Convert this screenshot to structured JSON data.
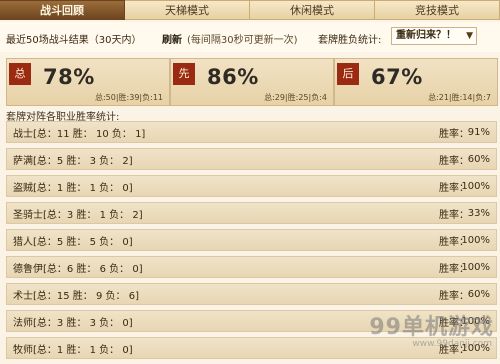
{
  "tabs": [
    {
      "label": "战斗回顾",
      "active": true
    },
    {
      "label": "天梯模式",
      "active": false
    },
    {
      "label": "休闲模式",
      "active": false
    },
    {
      "label": "竞技模式",
      "active": false
    }
  ],
  "filter": {
    "description": "最近50场战斗结果（30天内）",
    "refresh_label": "刷新",
    "refresh_note": "(每间隔30秒可更新一次)",
    "deck_stat_label": "套牌胜负统计:",
    "deck_select_value": "重新归来？！",
    "select_arrow": "▼"
  },
  "summary_cards": [
    {
      "badge": "总",
      "percent": "78%",
      "detail": "总:50|胜:39|负:11"
    },
    {
      "badge": "先",
      "percent": "86%",
      "detail": "总:29|胜:25|负:4"
    },
    {
      "badge": "后",
      "percent": "67%",
      "detail": "总:21|胜:14|负:7"
    }
  ],
  "section_title": "套牌对阵各职业胜率统计:",
  "class_rows": [
    {
      "text": "战士[总：11 胜： 10 负： 1]",
      "rate_label": "胜率：",
      "rate": "91%"
    },
    {
      "text": "萨满[总：5 胜： 3 负： 2]",
      "rate_label": "胜率：",
      "rate": "60%"
    },
    {
      "text": "盗贼[总：1 胜： 1 负： 0]",
      "rate_label": "胜率：",
      "rate": "100%"
    },
    {
      "text": "圣骑士[总：3 胜： 1 负： 2]",
      "rate_label": "胜率：",
      "rate": "33%"
    },
    {
      "text": "猎人[总：5 胜： 5 负： 0]",
      "rate_label": "胜率：",
      "rate": "100%"
    },
    {
      "text": "德鲁伊[总：6 胜： 6 负： 0]",
      "rate_label": "胜率：",
      "rate": "100%"
    },
    {
      "text": "术士[总：15 胜： 9 负： 6]",
      "rate_label": "胜率：",
      "rate": "60%"
    },
    {
      "text": "法师[总：3 胜： 3 负： 0]",
      "rate_label": "胜率：",
      "rate": "100%"
    },
    {
      "text": "牧师[总：1 胜： 1 负： 0]",
      "rate_label": "胜率：",
      "rate": "100%"
    }
  ],
  "watermark": {
    "big": "99单机游戏",
    "small": "www.99danji.com"
  }
}
